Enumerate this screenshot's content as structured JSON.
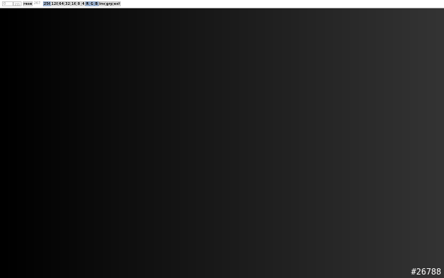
{
  "toolbar": {
    "value_input": "0",
    "max_input": "255",
    "reset_label": "reset",
    "count_readout": "267",
    "step_buttons": [
      {
        "label": "256",
        "active": true
      },
      {
        "label": "128",
        "active": false
      },
      {
        "label": "64",
        "active": false
      },
      {
        "label": "32",
        "active": false
      },
      {
        "label": "16",
        "active": false
      },
      {
        "label": "8",
        "active": false
      },
      {
        "label": "4",
        "active": false
      }
    ],
    "channel_buttons": [
      {
        "label": "R",
        "active": true
      },
      {
        "label": "G",
        "active": true
      },
      {
        "label": "B",
        "active": true
      }
    ],
    "inv_label": "inv",
    "grp_label": "grp",
    "exit_label": "exit"
  },
  "gradient": {
    "start_color": "#000000",
    "end_color": "#333333",
    "steps": 52
  },
  "tag": "#26788"
}
